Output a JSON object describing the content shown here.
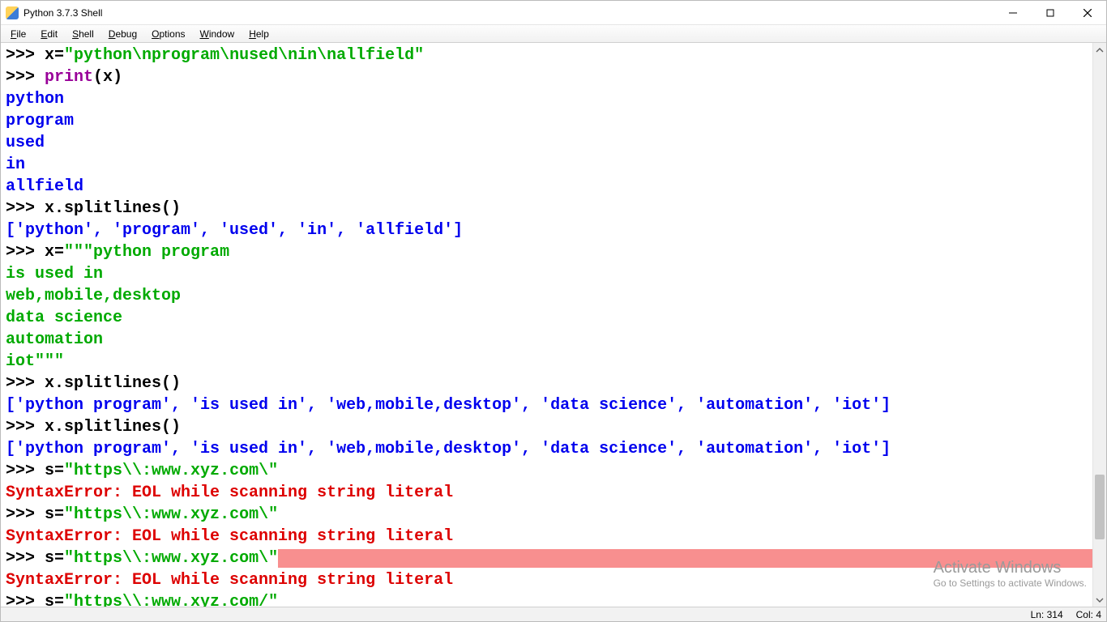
{
  "window": {
    "title": "Python 3.7.3 Shell"
  },
  "menus": {
    "file": "File",
    "file_u": "F",
    "edit": "Edit",
    "edit_u": "E",
    "shell": "Shell",
    "shell_u": "S",
    "debug": "Debug",
    "debug_u": "D",
    "options": "Options",
    "options_u": "O",
    "window": "Window",
    "window_u": "W",
    "help": "Help",
    "help_u": "H"
  },
  "status": {
    "ln_label": "Ln:",
    "ln_value": "314",
    "col_label": "Col:",
    "col_value": "4"
  },
  "watermark": {
    "line1": "Activate Windows",
    "line2": "Go to Settings to activate Windows."
  },
  "shell": {
    "prompt": ">>> ",
    "l1_var": "x=",
    "l1_str": "\"python\\nprogram\\nused\\nin\\nallfield\"",
    "l2_call": "print",
    "l2_paren_open": "(",
    "l2_arg": "x",
    "l2_paren_close": ")",
    "out_python": "python",
    "out_program": "program",
    "out_used": "used",
    "out_in": "in",
    "out_allfield": "allfield",
    "l3_code": "x.splitlines()",
    "out_split1": "['python', 'program', 'used', 'in', 'allfield']",
    "l4_var": "x=",
    "l4_str_a": "\"\"\"python program",
    "l4_str_b": "is used in",
    "l4_str_c": "web,mobile,desktop",
    "l4_str_d": "data science",
    "l4_str_e": "automation",
    "l4_str_f": "iot\"\"\"",
    "out_split2": "['python program', 'is used in', 'web,mobile,desktop', 'data science', 'automation', 'iot']",
    "l5_var": "s=",
    "l5_str": "\"https\\\\:www.xyz.com\\\"",
    "err_eol": "SyntaxError: EOL while scanning string literal",
    "l6_var": "s=",
    "l6_str": "\"https\\\\:www.xyz.com/\""
  }
}
